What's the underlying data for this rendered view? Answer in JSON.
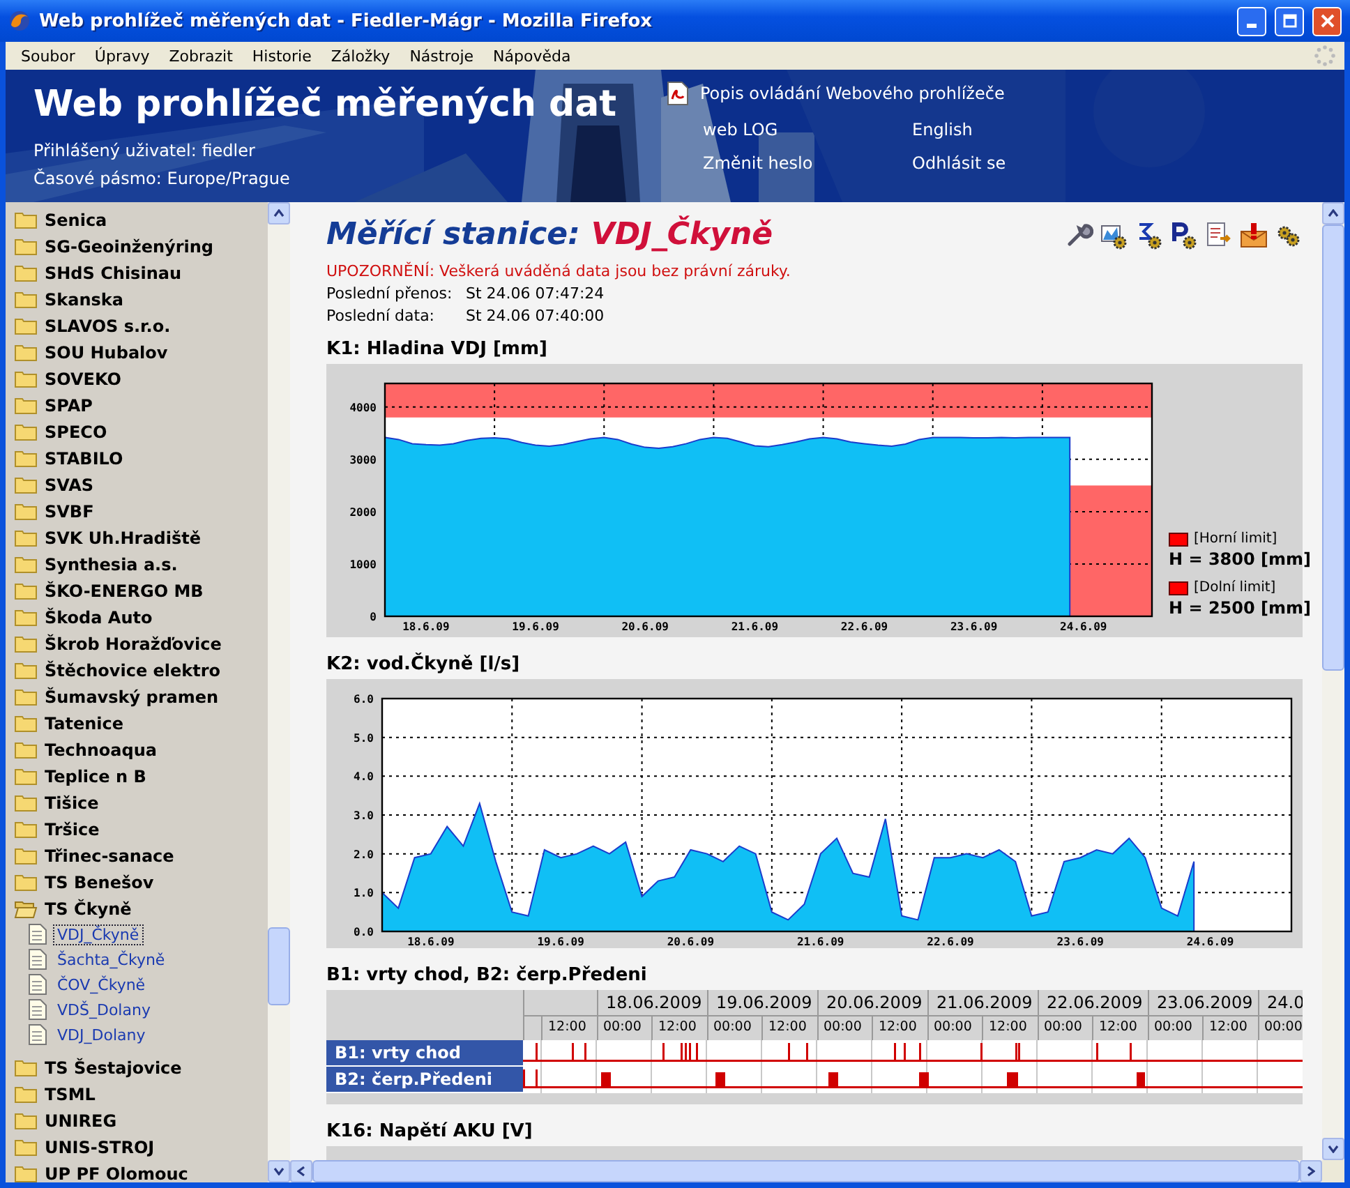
{
  "window": {
    "title": "Web prohlížeč měřených dat - Fiedler-Mágr - Mozilla Firefox"
  },
  "menu": [
    "Soubor",
    "Úpravy",
    "Zobrazit",
    "Historie",
    "Záložky",
    "Nástroje",
    "Nápověda"
  ],
  "header": {
    "title": "Web prohlížeč měřených dat",
    "user": "Přihlášený uživatel: fiedler",
    "timezone": "Časové pásmo: Europe/Prague",
    "manual_link": "Popis ovládání Webového prohlížeče",
    "links": [
      "web LOG",
      "English",
      "Změnit heslo",
      "Odhlásit se"
    ]
  },
  "sidebar": {
    "items": [
      {
        "label": "Senica",
        "expanded": false
      },
      {
        "label": "SG-Geoinženýring",
        "expanded": false
      },
      {
        "label": "SHdS Chisinau",
        "expanded": false
      },
      {
        "label": "Skanska",
        "expanded": false
      },
      {
        "label": "SLAVOS s.r.o.",
        "expanded": false
      },
      {
        "label": "SOU Hubalov",
        "expanded": false
      },
      {
        "label": "SOVEKO",
        "expanded": false
      },
      {
        "label": "SPAP",
        "expanded": false
      },
      {
        "label": "SPECO",
        "expanded": false
      },
      {
        "label": "STABILO",
        "expanded": false
      },
      {
        "label": "SVAS",
        "expanded": false
      },
      {
        "label": "SVBF",
        "expanded": false
      },
      {
        "label": "SVK Uh.Hradiště",
        "expanded": false
      },
      {
        "label": "Synthesia a.s.",
        "expanded": false
      },
      {
        "label": "ŠKO-ENERGO MB",
        "expanded": false
      },
      {
        "label": "Škoda Auto",
        "expanded": false
      },
      {
        "label": "Škrob Horažďovice",
        "expanded": false
      },
      {
        "label": "Štěchovice elektro",
        "expanded": false
      },
      {
        "label": "Šumavský pramen",
        "expanded": false
      },
      {
        "label": "Tatenice",
        "expanded": false
      },
      {
        "label": "Technoaqua",
        "expanded": false
      },
      {
        "label": "Teplice n B",
        "expanded": false
      },
      {
        "label": "Tišice",
        "expanded": false
      },
      {
        "label": "Tršice",
        "expanded": false
      },
      {
        "label": "Třinec-sanace",
        "expanded": false
      },
      {
        "label": "TS Benešov",
        "expanded": false
      },
      {
        "label": "TS Čkyně",
        "expanded": true,
        "children": [
          {
            "label": "VDJ_Čkyně",
            "selected": true
          },
          {
            "label": "Šachta_Čkyně",
            "selected": false
          },
          {
            "label": "ČOV_Čkyně",
            "selected": false
          },
          {
            "label": "VDŠ_Dolany",
            "selected": false
          },
          {
            "label": "VDJ_Dolany",
            "selected": false
          }
        ]
      },
      {
        "label": "TS Šestajovice",
        "expanded": false
      },
      {
        "label": "TSML",
        "expanded": false
      },
      {
        "label": "UNIREG",
        "expanded": false
      },
      {
        "label": "UNIS-STROJ",
        "expanded": false
      },
      {
        "label": "UP PF Olomouc",
        "expanded": false
      }
    ]
  },
  "station": {
    "heading": "Měřící stanice:",
    "name": "VDJ_Čkyně",
    "warning": "UPOZORNĚNÍ: Veškerá uváděná data jsou bez právní záruky.",
    "info": [
      {
        "label": "Poslední přenos:",
        "value": "St 24.06 07:47:24"
      },
      {
        "label": "Poslední data:",
        "value": "St 24.06 07:40:00"
      }
    ]
  },
  "sections": [
    {
      "kind": "chart",
      "title": "K1: Hladina VDJ [mm]",
      "chart_data": {
        "type": "area",
        "categories": [
          null,
          null,
          null,
          "18.6.09",
          null,
          null,
          null,
          null,
          null,
          null,
          null,
          "19.6.09",
          null,
          null,
          null,
          null,
          null,
          null,
          null,
          "20.6.09",
          null,
          null,
          null,
          null,
          null,
          null,
          null,
          "21.6.09",
          null,
          null,
          null,
          null,
          null,
          null,
          null,
          "22.6.09",
          null,
          null,
          null,
          null,
          null,
          null,
          null,
          "23.6.09",
          null,
          null,
          null,
          null,
          null,
          null,
          null,
          "24.6.09",
          null,
          null,
          null,
          null,
          null
        ],
        "series": [
          {
            "color": "#10bff5",
            "values": [
              3420,
              3380,
              3300,
              3280,
              3270,
              3300,
              3360,
              3400,
              3410,
              3390,
              3320,
              3270,
              3250,
              3280,
              3340,
              3390,
              3420,
              3380,
              3290,
              3230,
              3210,
              3240,
              3300,
              3380,
              3420,
              3400,
              3330,
              3260,
              3240,
              3280,
              3330,
              3390,
              3420,
              3390,
              3330,
              3300,
              3270,
              3250,
              3290,
              3380,
              3420,
              3420,
              3420,
              3410,
              3410,
              3420,
              3410,
              3420,
              3420,
              3420,
              3420,
              null,
              null,
              null,
              null,
              null,
              null
            ]
          }
        ],
        "grid": true,
        "ylim": [
          0,
          4450
        ],
        "yticks": [
          0,
          1000,
          2000,
          3000,
          4000
        ],
        "bands": [
          {
            "axis": "y",
            "from": 3800,
            "to": 4450
          },
          {
            "axis": "y",
            "from": 0,
            "to": 2500
          }
        ]
      },
      "legend": [
        {
          "label": "[Horní limit]",
          "text": "H = 3800 [mm]"
        },
        {
          "label": "[Dolní limit]",
          "text": "H = 2500 [mm]"
        }
      ]
    },
    {
      "kind": "chart",
      "title": "K2: vod.Čkyně [l/s]",
      "chart_data": {
        "type": "area",
        "categories": [
          null,
          null,
          null,
          "18.6.09",
          null,
          null,
          null,
          null,
          null,
          null,
          null,
          "19.6.09",
          null,
          null,
          null,
          null,
          null,
          null,
          null,
          "20.6.09",
          null,
          null,
          null,
          null,
          null,
          null,
          null,
          "21.6.09",
          null,
          null,
          null,
          null,
          null,
          null,
          null,
          "22.6.09",
          null,
          null,
          null,
          null,
          null,
          null,
          null,
          "23.6.09",
          null,
          null,
          null,
          null,
          null,
          null,
          null,
          "24.6.09",
          null,
          null,
          null,
          null,
          null
        ],
        "series": [
          {
            "color": "#10bff5",
            "values": [
              1.0,
              0.6,
              1.9,
              2.0,
              2.7,
              2.2,
              3.3,
              1.8,
              0.5,
              0.4,
              2.1,
              1.9,
              2.0,
              2.2,
              2.0,
              2.3,
              0.9,
              1.3,
              1.4,
              2.1,
              2.0,
              1.8,
              2.2,
              2.0,
              0.5,
              0.3,
              0.7,
              2.0,
              2.4,
              1.5,
              1.4,
              2.9,
              0.4,
              0.3,
              1.9,
              1.9,
              2.0,
              1.9,
              2.1,
              1.8,
              0.4,
              0.5,
              1.8,
              1.9,
              2.1,
              2.0,
              2.4,
              1.9,
              0.6,
              0.4,
              1.8,
              null,
              null,
              null,
              null,
              null,
              null
            ]
          }
        ],
        "grid": true,
        "ylim": [
          0,
          6
        ],
        "yticks": [
          {
            "value": 0,
            "label": "0.0"
          },
          {
            "value": 1,
            "label": "1.0"
          },
          {
            "value": 2,
            "label": "2.0"
          },
          {
            "value": 3,
            "label": "3.0"
          },
          {
            "value": 4,
            "label": "4.0"
          },
          {
            "value": 5,
            "label": "5.0"
          },
          {
            "value": 6,
            "label": "6.0"
          }
        ]
      }
    },
    {
      "kind": "timeline",
      "title": "B1: vrty chod, B2: čerp.Předeni",
      "dates": [
        "18.06.2009",
        "19.06.2009",
        "20.06.2009",
        "21.06.2009",
        "22.06.2009",
        "23.06.2009",
        "24.0"
      ],
      "hours": [
        "12:00",
        "00:00",
        "12:00",
        "00:00",
        "12:00",
        "00:00",
        "12:00",
        "00:00",
        "12:00",
        "00:00",
        "12:00",
        "00:00",
        "12:00",
        "00:00"
      ],
      "rows": [
        "B1: vrty chod",
        "B2: čerp.Předeni"
      ]
    },
    {
      "kind": "empty",
      "title": "K16: Napětí AKU [V]"
    }
  ]
}
